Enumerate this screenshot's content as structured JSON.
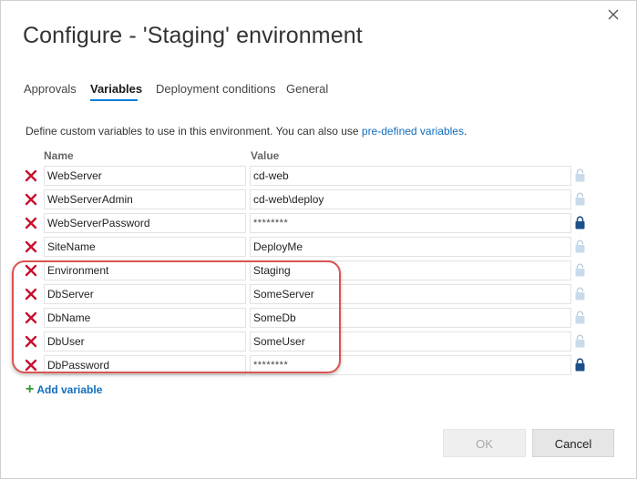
{
  "dialog": {
    "title": "Configure - 'Staging' environment",
    "close_icon": "close-icon"
  },
  "tabs": [
    {
      "label": "Approvals",
      "active": false
    },
    {
      "label": "Variables",
      "active": true
    },
    {
      "label": "Deployment conditions",
      "active": false
    },
    {
      "label": "General",
      "active": false
    }
  ],
  "accent_color": "#0a7fd9",
  "description": {
    "text": "Define custom variables to use in this environment. You can also use ",
    "link": "pre-defined variables",
    "suffix": "."
  },
  "columns": {
    "name": "Name",
    "value": "Value"
  },
  "variables": [
    {
      "name": "WebServer",
      "value": "cd-web",
      "secret": false
    },
    {
      "name": "WebServerAdmin",
      "value": "cd-web\\deploy",
      "secret": false
    },
    {
      "name": "WebServerPassword",
      "value": "********",
      "secret": true
    },
    {
      "name": "SiteName",
      "value": "DeployMe",
      "secret": false
    },
    {
      "name": "Environment",
      "value": "Staging",
      "secret": false
    },
    {
      "name": "DbServer",
      "value": "SomeServer",
      "secret": false
    },
    {
      "name": "DbName",
      "value": "SomeDb",
      "secret": false
    },
    {
      "name": "DbUser",
      "value": "SomeUser",
      "secret": false
    },
    {
      "name": "DbPassword",
      "value": "********",
      "secret": true
    }
  ],
  "add_variable": "Add variable",
  "buttons": {
    "ok": "OK",
    "cancel": "Cancel"
  },
  "highlight_color": "#d9534f"
}
